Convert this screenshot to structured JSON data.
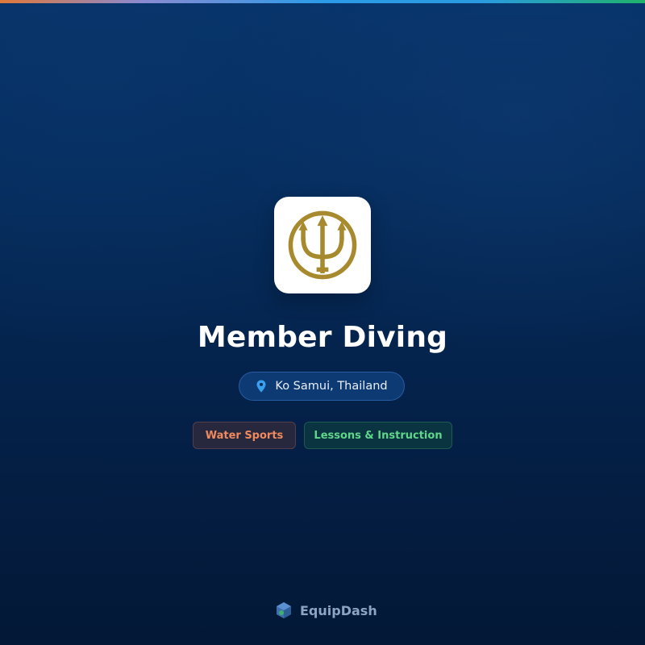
{
  "header": {
    "accent_gradient": [
      "#e0783a",
      "#8b8ad0",
      "#2b9be8",
      "#1fb26a"
    ]
  },
  "profile": {
    "logo_icon": "trident-icon",
    "logo_color": "#a88a2e",
    "name": "Member Diving",
    "location": {
      "icon": "map-pin-icon",
      "text": "Ko Samui, Thailand"
    },
    "tags": [
      {
        "label": "Water Sports",
        "color": "#f08a5d"
      },
      {
        "label": "Lessons & Instruction",
        "color": "#5fd68a"
      }
    ]
  },
  "footer": {
    "brand_icon": "equipdash-logo-icon",
    "brand_name": "EquipDash"
  },
  "colors": {
    "background": "#052a58",
    "title": "#ffffff",
    "pin": "#3aa0f0"
  }
}
